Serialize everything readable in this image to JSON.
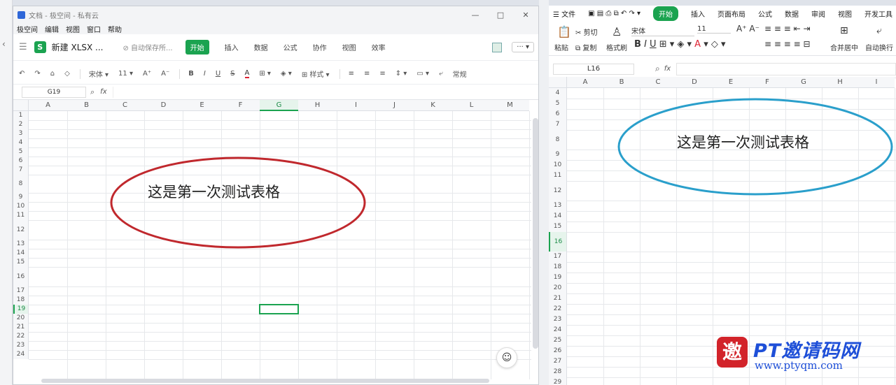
{
  "left_window": {
    "title": "文档 - 极空间 - 私有云",
    "window_controls": [
      "—",
      "□",
      "✕"
    ],
    "menu": [
      "极空间",
      "编辑",
      "视图",
      "窗口",
      "帮助"
    ],
    "doc_name": "新建 XLSX ...",
    "autosave": "自动保存所...",
    "tabs": [
      "开始",
      "插入",
      "数据",
      "公式",
      "协作",
      "视图",
      "效率"
    ],
    "more": "··· ▾",
    "toolbar": {
      "font": "宋体 ▾",
      "size": "11 ▾",
      "bold": "B",
      "italic": "I",
      "underline": "U",
      "strike": "S",
      "font_color": "A",
      "style": "样式 ▾",
      "normal": "常规"
    },
    "name_box": "G19",
    "fx": "fx",
    "columns": [
      "A",
      "B",
      "C",
      "D",
      "E",
      "F",
      "G",
      "H",
      "I",
      "J",
      "K",
      "L",
      "M"
    ],
    "rows": [
      "1",
      "2",
      "3",
      "4",
      "5",
      "6",
      "7",
      "8",
      "9",
      "10",
      "11",
      "12",
      "13",
      "14",
      "15",
      "16",
      "17",
      "18",
      "19",
      "20",
      "21",
      "22",
      "23",
      "24"
    ],
    "selected_column": "G",
    "selected_row": "19",
    "shape_text": "这是第一次测试表格",
    "shape_color": "#c0282d"
  },
  "right_window": {
    "menu": [
      "☰ 文件",
      "开始",
      "插入",
      "页面布局",
      "公式",
      "数据",
      "审阅",
      "视图",
      "开发工具"
    ],
    "ribbon": {
      "paste": "粘贴",
      "cut": "剪切",
      "copy": "复制",
      "format_painter": "格式刷",
      "font": "宋体",
      "size": "11",
      "merge_center": "合并居中",
      "auto_wrap": "自动换行"
    },
    "name_box": "L16",
    "fx": "fx",
    "columns": [
      "A",
      "B",
      "C",
      "D",
      "E",
      "F",
      "G",
      "H",
      "I"
    ],
    "rows": [
      "4",
      "5",
      "6",
      "7",
      "8",
      "9",
      "10",
      "11",
      "12",
      "13",
      "14",
      "15",
      "16",
      "17",
      "18",
      "19",
      "20",
      "21",
      "22",
      "23",
      "24",
      "25",
      "26",
      "27",
      "28",
      "29"
    ],
    "selected_row": "16",
    "shape_text": "这是第一次测试表格",
    "shape_color": "#2a9fcb"
  },
  "watermark": {
    "logo_char": "邀",
    "title": "PT邀请码网",
    "url": "www.ptyqm.com"
  }
}
